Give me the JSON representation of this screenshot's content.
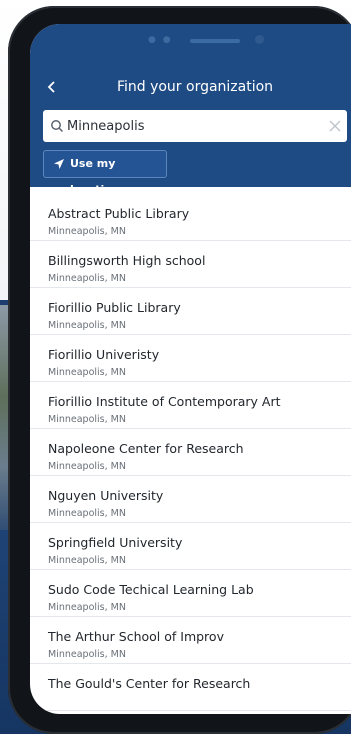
{
  "header": {
    "title": "Find your organization",
    "back_icon": "chevron-left-icon"
  },
  "search": {
    "value": "Minneapolis",
    "placeholder": "",
    "icon": "search-icon",
    "clear_icon": "close-icon"
  },
  "location_button": {
    "label": "Use my location",
    "icon": "navigation-arrow-icon"
  },
  "colors": {
    "header_bg": "#1f4b84",
    "text_primary": "#22272d",
    "text_secondary": "#6a7079"
  },
  "results": [
    {
      "name": "Abstract Public Library",
      "location": "Minneapolis, MN"
    },
    {
      "name": "Billingsworth High school",
      "location": "Minneapolis, MN"
    },
    {
      "name": "Fiorillio Public Library",
      "location": "Minneapolis, MN"
    },
    {
      "name": "Fiorillio Univeristy",
      "location": "Minneapolis, MN"
    },
    {
      "name": "Fiorillio Institute of Contemporary Art",
      "location": "Minneapolis, MN"
    },
    {
      "name": "Napoleone Center for Research",
      "location": "Minneapolis, MN"
    },
    {
      "name": "Nguyen University",
      "location": "Minneapolis, MN"
    },
    {
      "name": "Springfield University",
      "location": "Minneapolis, MN"
    },
    {
      "name": "Sudo Code Techical Learning Lab",
      "location": "Minneapolis, MN"
    },
    {
      "name": "The Arthur School of Improv",
      "location": "Minneapolis, MN"
    },
    {
      "name": "The Gould's Center for Research",
      "location": ""
    }
  ]
}
